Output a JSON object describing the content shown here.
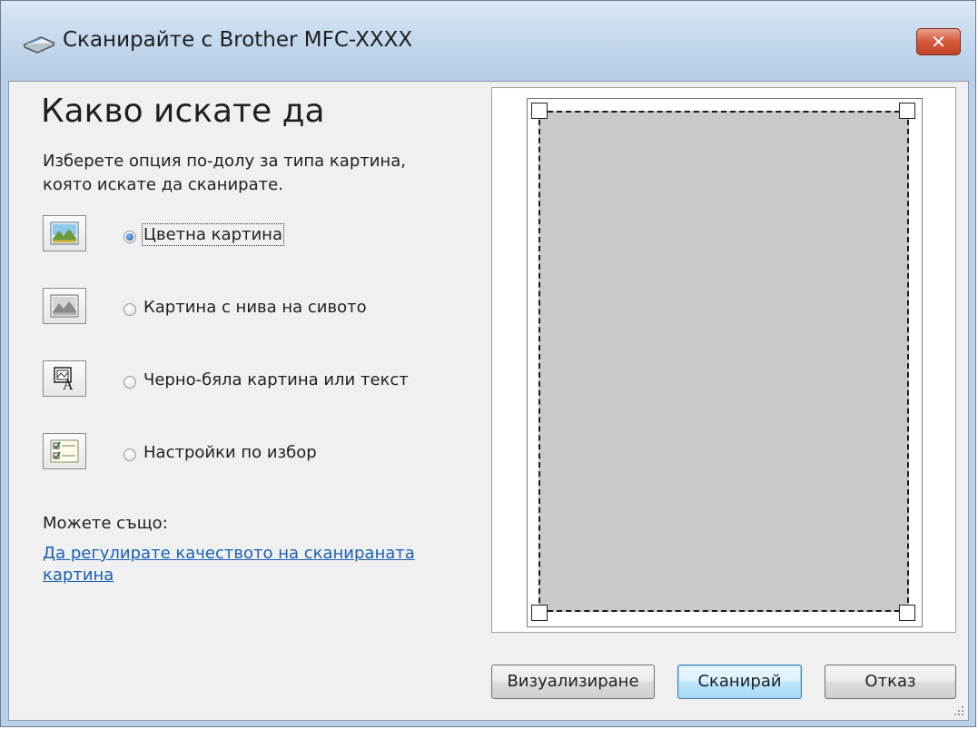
{
  "window": {
    "title": "Сканирайте с Brother MFC-XXXX",
    "close_label": "✕"
  },
  "main": {
    "heading": "Какво искате да",
    "description": "Изберете опция по-долу за типа картина, която искате да сканирате.",
    "options": [
      {
        "label": "Цветна картина",
        "checked": true,
        "icon": "color-picture-icon"
      },
      {
        "label": "Картина с нива на сивото",
        "checked": false,
        "icon": "grayscale-picture-icon"
      },
      {
        "label": "Черно-бяла картина или текст",
        "checked": false,
        "icon": "bw-text-icon"
      },
      {
        "label": "Настройки по избор",
        "checked": false,
        "icon": "custom-settings-icon"
      }
    ],
    "also_label": "Можете също:",
    "adjust_link": "Да регулирате качеството на сканираната картина"
  },
  "buttons": {
    "preview": "Визуализиране",
    "scan": "Сканирай",
    "cancel": "Отказ"
  }
}
